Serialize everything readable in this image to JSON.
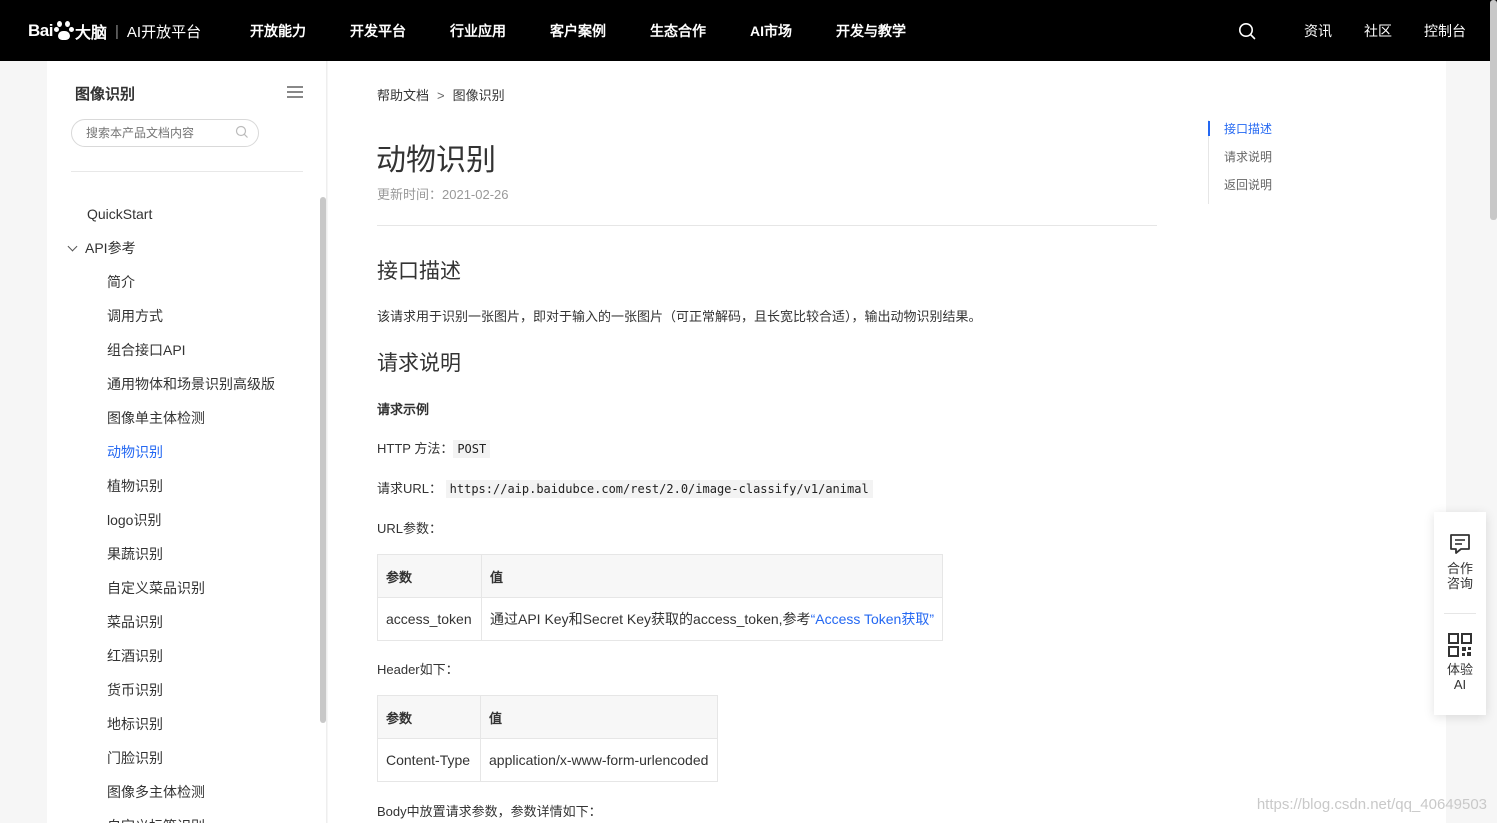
{
  "nav": {
    "logo_bai": "Bai",
    "logo_brain": "大脑",
    "logo_sep": "|",
    "logo_platform": "AI开放平台",
    "links": [
      "开放能力",
      "开发平台",
      "行业应用",
      "客户案例",
      "生态合作",
      "AI市场",
      "开发与教学"
    ],
    "right": [
      "资讯",
      "社区",
      "控制台"
    ]
  },
  "sidebar": {
    "title": "图像识别",
    "search_placeholder": "搜索本产品文档内容",
    "items": [
      "QuickStart",
      "API参考",
      "简介",
      "调用方式",
      "组合接口API",
      "通用物体和场景识别高级版",
      "图像单主体检测",
      "动物识别",
      "植物识别",
      "logo识别",
      "果蔬识别",
      "自定义菜品识别",
      "菜品识别",
      "红酒识别",
      "货币识别",
      "地标识别",
      "门脸识别",
      "图像多主体检测",
      "自定义标签识别"
    ]
  },
  "content": {
    "breadcrumb": [
      "帮助文档",
      "图像识别"
    ],
    "breadcrumb_sep": ">",
    "title": "动物识别",
    "update_label": "更新时间：",
    "update_date": "2021-02-26",
    "section1_title": "接口描述",
    "section1_desc": "该请求用于识别一张图片，即对于输入的一张图片（可正常解码，且长宽比较合适），输出动物识别结果。",
    "section2_title": "请求说明",
    "request_example": "请求示例",
    "http_method_label": "HTTP 方法：",
    "http_method": "POST",
    "request_url_label": "请求URL：",
    "request_url": "https://aip.baidubce.com/rest/2.0/image-classify/v1/animal",
    "url_params_label": "URL参数：",
    "table1": {
      "headers": [
        "参数",
        "值"
      ],
      "row_param": "access_token",
      "row_value_prefix": "通过API Key和Secret Key获取的access_token,参考",
      "row_value_link": "“Access Token获取”"
    },
    "header_label": "Header如下：",
    "table2": {
      "headers": [
        "参数",
        "值"
      ],
      "row_param": "Content-Type",
      "row_value": "application/x-www-form-urlencoded"
    },
    "body_label": "Body中放置请求参数，参数详情如下："
  },
  "toc": [
    "接口描述",
    "请求说明",
    "返回说明"
  ],
  "float": {
    "consult_line1": "合作",
    "consult_line2": "咨询",
    "try_line1": "体验",
    "try_line2": "AI"
  },
  "watermark": "https://blog.csdn.net/qq_40649503",
  "colors": {
    "accent": "#2468f2",
    "nav_bg": "#000000"
  }
}
